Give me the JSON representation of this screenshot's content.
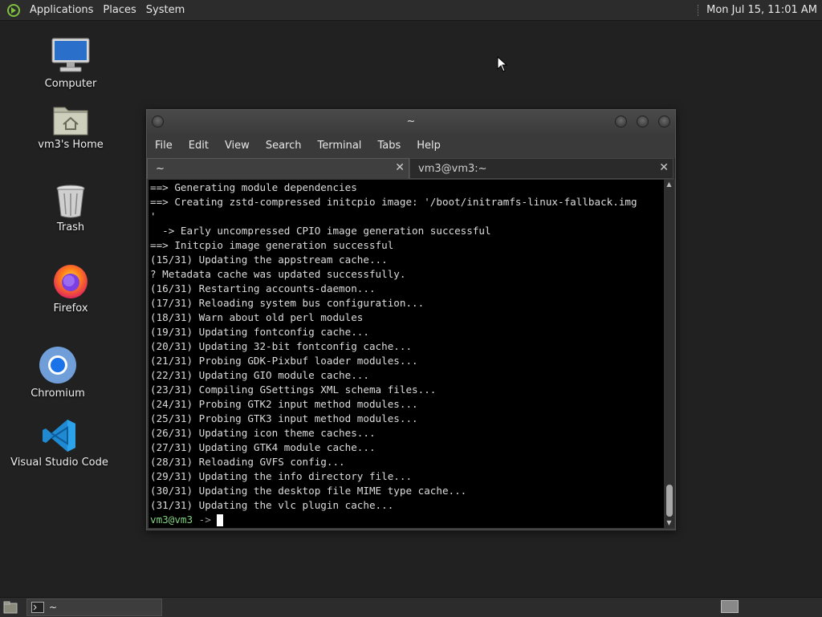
{
  "top_panel": {
    "menus": [
      "Applications",
      "Places",
      "System"
    ],
    "clock": "Mon Jul 15, 11:01 AM"
  },
  "desktop_icons": [
    {
      "label": "Computer",
      "icon": "computer-icon"
    },
    {
      "label": "vm3's Home",
      "icon": "home-folder-icon"
    },
    {
      "label": "Trash",
      "icon": "trash-icon"
    },
    {
      "label": "Firefox",
      "icon": "firefox-icon"
    },
    {
      "label": "Chromium",
      "icon": "chromium-icon"
    },
    {
      "label": "Visual Studio Code",
      "icon": "vscode-icon"
    }
  ],
  "terminal": {
    "title": "~",
    "menu": [
      "File",
      "Edit",
      "View",
      "Search",
      "Terminal",
      "Tabs",
      "Help"
    ],
    "tabs": [
      {
        "label": "~",
        "active": true
      },
      {
        "label": "vm3@vm3:~",
        "active": false
      }
    ],
    "lines": [
      "==> Generating module dependencies",
      "==> Creating zstd-compressed initcpio image: '/boot/initramfs-linux-fallback.img",
      "'",
      "  -> Early uncompressed CPIO image generation successful",
      "==> Initcpio image generation successful",
      "(15/31) Updating the appstream cache...",
      "? Metadata cache was updated successfully.",
      "(16/31) Restarting accounts-daemon...",
      "(17/31) Reloading system bus configuration...",
      "(18/31) Warn about old perl modules",
      "(19/31) Updating fontconfig cache...",
      "(20/31) Updating 32-bit fontconfig cache...",
      "(21/31) Probing GDK-Pixbuf loader modules...",
      "(22/31) Updating GIO module cache...",
      "(23/31) Compiling GSettings XML schema files...",
      "(24/31) Probing GTK2 input method modules...",
      "(25/31) Probing GTK3 input method modules...",
      "(26/31) Updating icon theme caches...",
      "(27/31) Updating GTK4 module cache...",
      "(28/31) Reloading GVFS config...",
      "(29/31) Updating the info directory file...",
      "(30/31) Updating the desktop file MIME type cache...",
      "(31/31) Updating the vlc plugin cache..."
    ],
    "prompt_user": "vm3@vm3",
    "prompt_symbol": " ->"
  },
  "taskbar": {
    "task_label": "~"
  },
  "colors": {
    "prompt_user": "#7fd27f",
    "terminal_bg": "#000000",
    "desktop_bg": "#212121"
  }
}
